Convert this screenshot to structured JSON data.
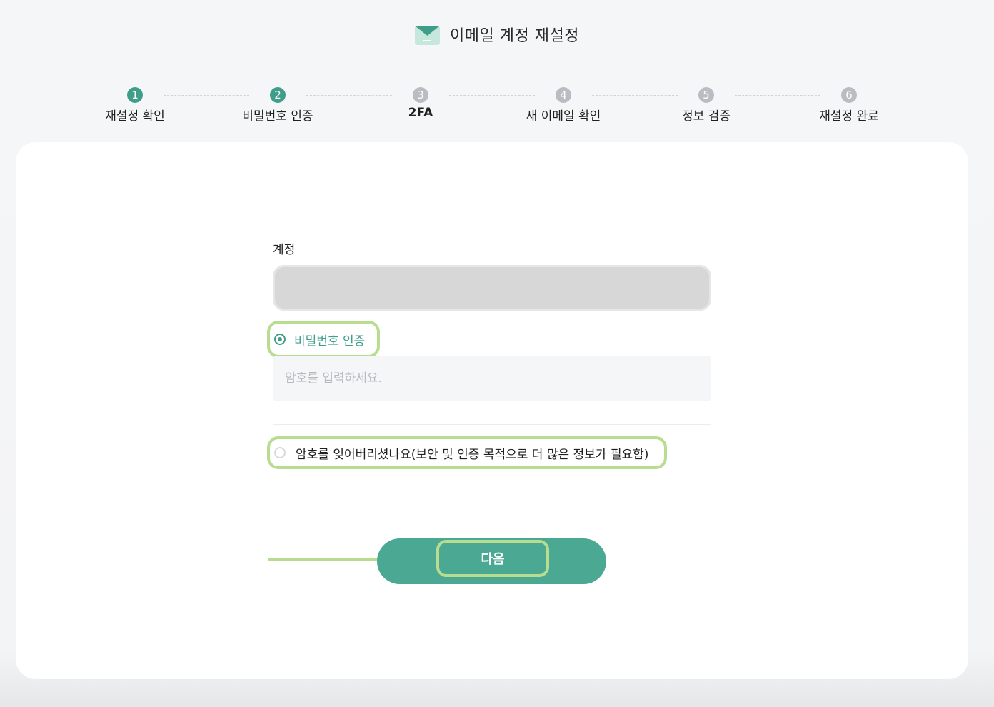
{
  "header": {
    "title": "이메일 계정 재설정",
    "icon": "mail-icon"
  },
  "steps": [
    {
      "number": "1",
      "label": "재설정 확인",
      "state": "done"
    },
    {
      "number": "2",
      "label": "비밀번호 인증",
      "state": "done"
    },
    {
      "number": "3",
      "label": "2FA",
      "state": "current"
    },
    {
      "number": "4",
      "label": "새 이메일 확인",
      "state": "todo"
    },
    {
      "number": "5",
      "label": "정보 검증",
      "state": "todo"
    },
    {
      "number": "6",
      "label": "재설정 완료",
      "state": "todo"
    }
  ],
  "form": {
    "account_label": "계정",
    "account_value": "",
    "option_password": {
      "label": "비밀번호 인증",
      "checked": true
    },
    "password_placeholder": "암호를 입력하세요.",
    "password_value": "",
    "option_forgot": {
      "label": "암호를 잊어버리셨나요(보안 및 인증 목적으로 더 많은 정보가 필요함)",
      "checked": false
    }
  },
  "actions": {
    "next_label": "다음"
  },
  "colors": {
    "accent": "#3f9e8a",
    "button": "#4ba893",
    "highlight": "#b8dc90",
    "inactive_step": "#b9bcc1"
  }
}
